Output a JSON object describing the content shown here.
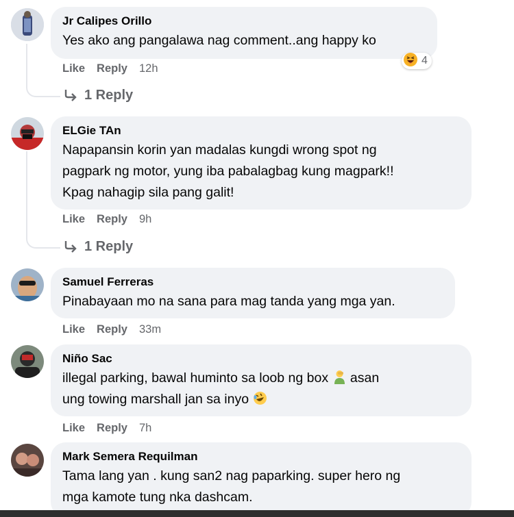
{
  "comments": [
    {
      "name": "Jr Calipes Orillo",
      "lines": [
        "Yes ako ang pangalawa nag comment..ang happy ko"
      ],
      "like": "Like",
      "reply": "Reply",
      "time": "12h",
      "reaction_count": "4",
      "reaction_icon": "haha-emoji-icon",
      "replies_label": "1 Reply"
    },
    {
      "name": "ELGie TAn",
      "lines": [
        "Napapansin korin yan madalas kungdi wrong spot ng",
        "pagpark ng motor, yung iba pabalagbag kung magpark!!",
        "Kpag nahagip sila pang galit!"
      ],
      "like": "Like",
      "reply": "Reply",
      "time": "9h",
      "replies_label": "1 Reply"
    },
    {
      "name": "Samuel Ferreras",
      "lines": [
        "Pinabayaan mo na sana para mag tanda yang mga yan."
      ],
      "like": "Like",
      "reply": "Reply",
      "time": "33m"
    },
    {
      "name": "Niño Sac",
      "line1": "illegal parking, bawal huminto sa loob ng box",
      "line1_after": "asan",
      "line2": "ung towing marshall jan sa inyo",
      "inline_icons": [
        "person-facepalming-icon",
        "rolling-laughing-icon"
      ],
      "like": "Like",
      "reply": "Reply",
      "time": "7h"
    },
    {
      "name": "Mark Semera Requilman",
      "lines": [
        "Tama lang yan . kung san2 nag paparking. super hero ng",
        "mga kamote tung nka dashcam."
      ]
    }
  ],
  "colors": {
    "bubble": "#f0f2f5",
    "meta_text": "#65676b",
    "thread_line": "#e4e6eb"
  }
}
